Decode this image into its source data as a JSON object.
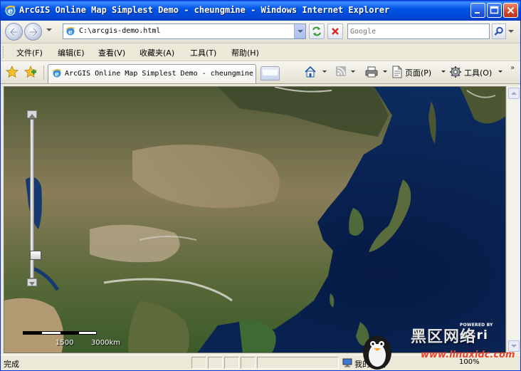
{
  "window": {
    "title": "ArcGIS Online Map Simplest Demo - cheungmine - Windows Internet Explorer"
  },
  "address_bar": {
    "url": "C:\\arcgis-demo.html"
  },
  "search": {
    "placeholder": "Google"
  },
  "menu": {
    "items": [
      "文件(F)",
      "编辑(E)",
      "查看(V)",
      "收藏夹(A)",
      "工具(T)",
      "帮助(H)"
    ]
  },
  "tabs": [
    {
      "label": "ArcGIS Online Map Simplest Demo - cheungmine"
    }
  ],
  "command_bar": {
    "page_label": "页面(P)",
    "tools_label": "工具(O)",
    "chevron": "»"
  },
  "map": {
    "scale_labels": [
      "1500",
      "3000km"
    ],
    "powered_by": "POWERED BY",
    "logo_text": "esri"
  },
  "status": {
    "text": "完成",
    "zone": "我的电脑",
    "zoom": "100%"
  },
  "watermark": {
    "text": "黑区网络",
    "url": "www.linuxidc.com"
  },
  "colors": {
    "titlebar": "#0055e5",
    "close_button": "#d5502e",
    "ocean": "#0c2550"
  }
}
